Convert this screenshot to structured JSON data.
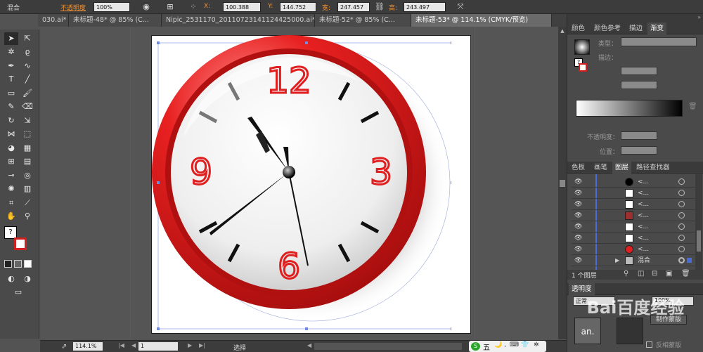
{
  "control_bar": {
    "mode_label": "混合",
    "opacity_label": "不透明度",
    "opacity_value": "100%",
    "x_label": "X:",
    "x_value": "100.388",
    "y_label": "Y:",
    "y_value": "144.752",
    "width_label": "宽:",
    "width_value": "247.457",
    "height_label": "高:",
    "height_value": "243.497"
  },
  "tabs": [
    {
      "label": "030.ai* ×"
    },
    {
      "label": "未标题-48* @ 85% (C..."
    },
    {
      "label": "Nipic_2531170_20110723141124425000.ai* ×"
    },
    {
      "label": "未标题-52* @ 85% (C..."
    },
    {
      "label": "未标题-53* @ 114.1% (CMYK/预览)"
    }
  ],
  "clock": {
    "numerals": [
      "12",
      "3",
      "6",
      "9"
    ],
    "colors": {
      "rim": "#e02020",
      "numeral": "#e02020",
      "face": "#f4f4f4"
    }
  },
  "statusbar": {
    "zoom": "114.1%",
    "page": "1",
    "mode": "选择",
    "ime": "五"
  },
  "gradient_panel": {
    "tabs": [
      "颜色",
      "颜色参考",
      "描边",
      "渐变"
    ],
    "type_label": "类型：",
    "stroke_label": "描边：",
    "opacity_label": "不透明度：",
    "location_label": "位置："
  },
  "layers_panel": {
    "tabs": [
      "色板",
      "画笔",
      "图层",
      "路径查找器"
    ],
    "rows": [
      {
        "name": "<...",
        "thumb": "#000000"
      },
      {
        "name": "<...",
        "thumb": "#ffffff"
      },
      {
        "name": "<...",
        "thumb": "#ffffff"
      },
      {
        "name": "<...",
        "thumb": "#9a3030"
      },
      {
        "name": "<...",
        "thumb": "#ffffff"
      },
      {
        "name": "<...",
        "thumb": "#ffffff"
      },
      {
        "name": "<...",
        "thumb": "#e02020"
      },
      {
        "name": "混合",
        "thumb": "#bbbbbb"
      }
    ],
    "layer_count": "1 个图层"
  },
  "transparency_panel": {
    "title": "透明度",
    "mode": "正常",
    "opacity": "100%",
    "mask_button": "制作蒙版",
    "thumb_text": "an.",
    "invert_label": "反相蒙版"
  },
  "watermark": "Bai百度经验"
}
